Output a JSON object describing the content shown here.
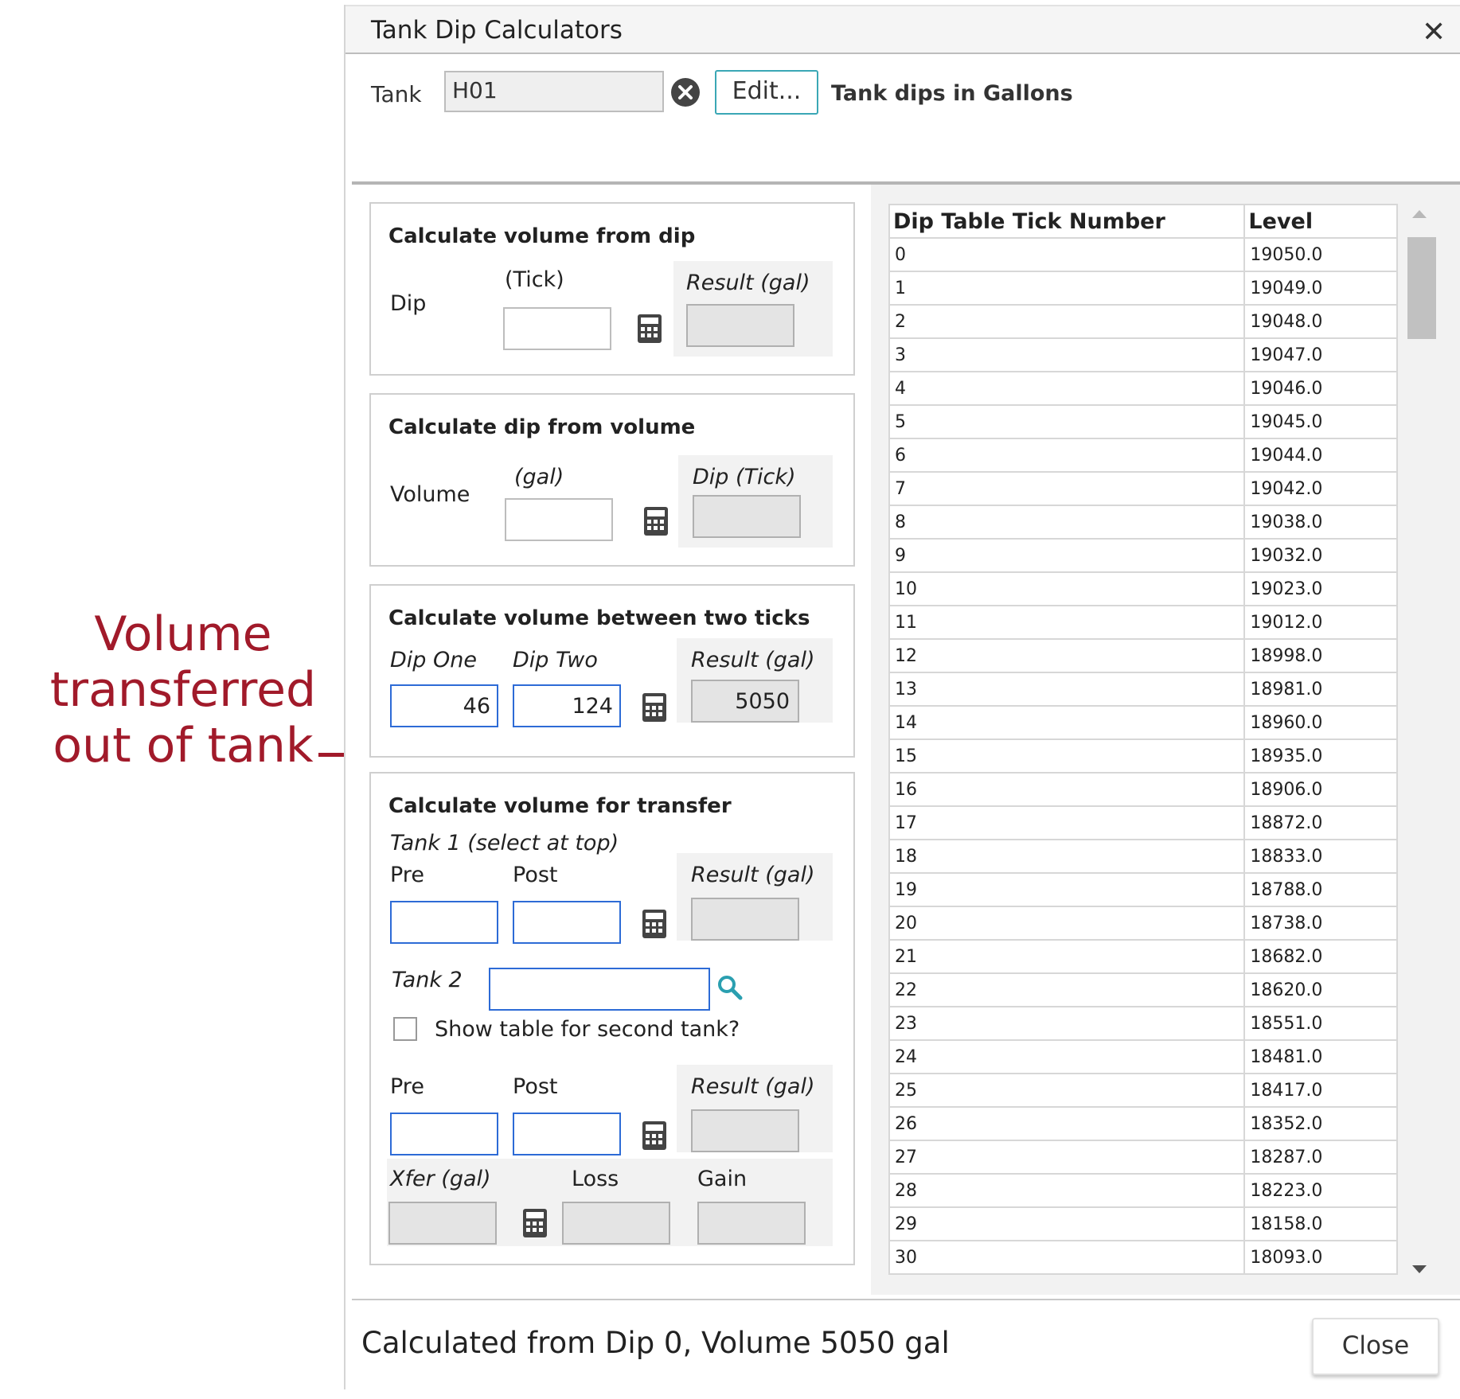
{
  "annotation": {
    "lines": [
      "Volume",
      "transferred",
      "out of tank"
    ],
    "color": "#a11a2a"
  },
  "dialog": {
    "title": "Tank Dip Calculators",
    "close_icon": "close-x-icon"
  },
  "toolbar": {
    "tank_label": "Tank",
    "tank_value": "H01",
    "clear_icon": "clear-circle-icon",
    "edit_label": "Edit...",
    "units_label": "Tank dips in Gallons"
  },
  "panel_volume_from_dip": {
    "title": "Calculate volume from dip",
    "dip_label": "Dip",
    "tick_label": "(Tick)",
    "dip_value": "",
    "result_label": "Result (gal)",
    "result_value": ""
  },
  "panel_dip_from_volume": {
    "title": "Calculate dip from volume",
    "volume_label": "Volume",
    "gal_label": "(gal)",
    "volume_value": "",
    "result_label": "Dip (Tick)",
    "result_value": ""
  },
  "panel_between_ticks": {
    "title": "Calculate volume between two ticks",
    "dip_one_label": "Dip One",
    "dip_two_label": "Dip Two",
    "dip_one_value": "46",
    "dip_two_value": "124",
    "result_label": "Result (gal)",
    "result_value": "5050"
  },
  "panel_transfer": {
    "title": "Calculate volume for transfer",
    "tank1_label": "Tank 1 (select at top)",
    "pre_label": "Pre",
    "post_label": "Post",
    "result_label": "Result (gal)",
    "tank2_label": "Tank 2",
    "tank2_value": "",
    "search_icon": "search-icon",
    "show_table_label": "Show table for second tank?",
    "show_table_checked": false,
    "pre2_label": "Pre",
    "post2_label": "Post",
    "result2_label": "Result (gal)",
    "xfer_label": "Xfer (gal)",
    "loss_label": "Loss",
    "gain_label": "Gain"
  },
  "dip_table": {
    "headers": [
      "Dip Table Tick Number",
      "Level"
    ],
    "rows": [
      [
        "0",
        "19050.0"
      ],
      [
        "1",
        "19049.0"
      ],
      [
        "2",
        "19048.0"
      ],
      [
        "3",
        "19047.0"
      ],
      [
        "4",
        "19046.0"
      ],
      [
        "5",
        "19045.0"
      ],
      [
        "6",
        "19044.0"
      ],
      [
        "7",
        "19042.0"
      ],
      [
        "8",
        "19038.0"
      ],
      [
        "9",
        "19032.0"
      ],
      [
        "10",
        "19023.0"
      ],
      [
        "11",
        "19012.0"
      ],
      [
        "12",
        "18998.0"
      ],
      [
        "13",
        "18981.0"
      ],
      [
        "14",
        "18960.0"
      ],
      [
        "15",
        "18935.0"
      ],
      [
        "16",
        "18906.0"
      ],
      [
        "17",
        "18872.0"
      ],
      [
        "18",
        "18833.0"
      ],
      [
        "19",
        "18788.0"
      ],
      [
        "20",
        "18738.0"
      ],
      [
        "21",
        "18682.0"
      ],
      [
        "22",
        "18620.0"
      ],
      [
        "23",
        "18551.0"
      ],
      [
        "24",
        "18481.0"
      ],
      [
        "25",
        "18417.0"
      ],
      [
        "26",
        "18352.0"
      ],
      [
        "27",
        "18287.0"
      ],
      [
        "28",
        "18223.0"
      ],
      [
        "29",
        "18158.0"
      ],
      [
        "30",
        "18093.0"
      ]
    ]
  },
  "footer": {
    "status": "Calculated from Dip 0, Volume 5050 gal",
    "close_label": "Close"
  }
}
